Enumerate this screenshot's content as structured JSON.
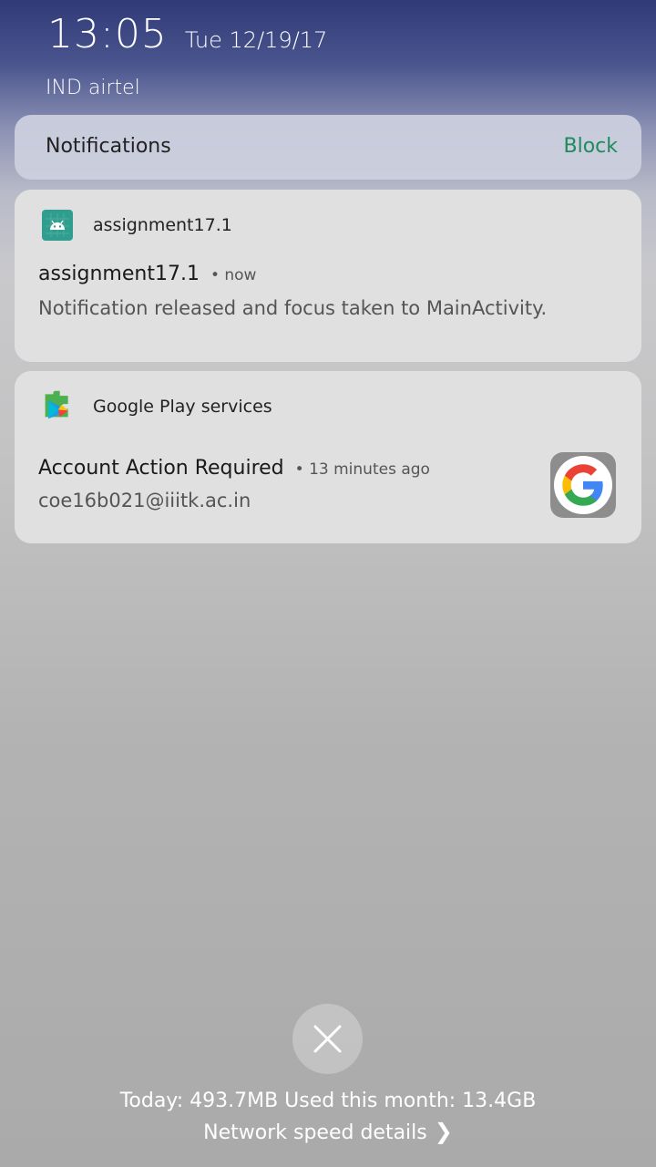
{
  "status_bar": {
    "time": "13:05",
    "date": "Tue 12/19/17",
    "carrier": "IND airtel"
  },
  "notifications_header": {
    "title": "Notifications",
    "block_label": "Block"
  },
  "notifications": [
    {
      "app_name": "assignment17.1",
      "icon": "android-icon",
      "title": "assignment17.1",
      "time": "• now",
      "body": "Notification released and focus taken to MainActivity."
    },
    {
      "app_name": "Google Play services",
      "icon": "google-play-services-icon",
      "title": "Account Action Required",
      "time": "• 13 minutes ago",
      "body": "coe16b021@iiitk.ac.in",
      "thumbnail": "google-g-icon"
    }
  ],
  "footer": {
    "close_icon": "close-icon",
    "usage_text": "Today: 493.7MB Used this month: 13.4GB",
    "network_details_label": "Network speed details",
    "chevron_icon": "chevron-right-icon"
  },
  "colors": {
    "block_accent": "#1f8a5e",
    "android_icon_bg": "#2f9e8f"
  }
}
